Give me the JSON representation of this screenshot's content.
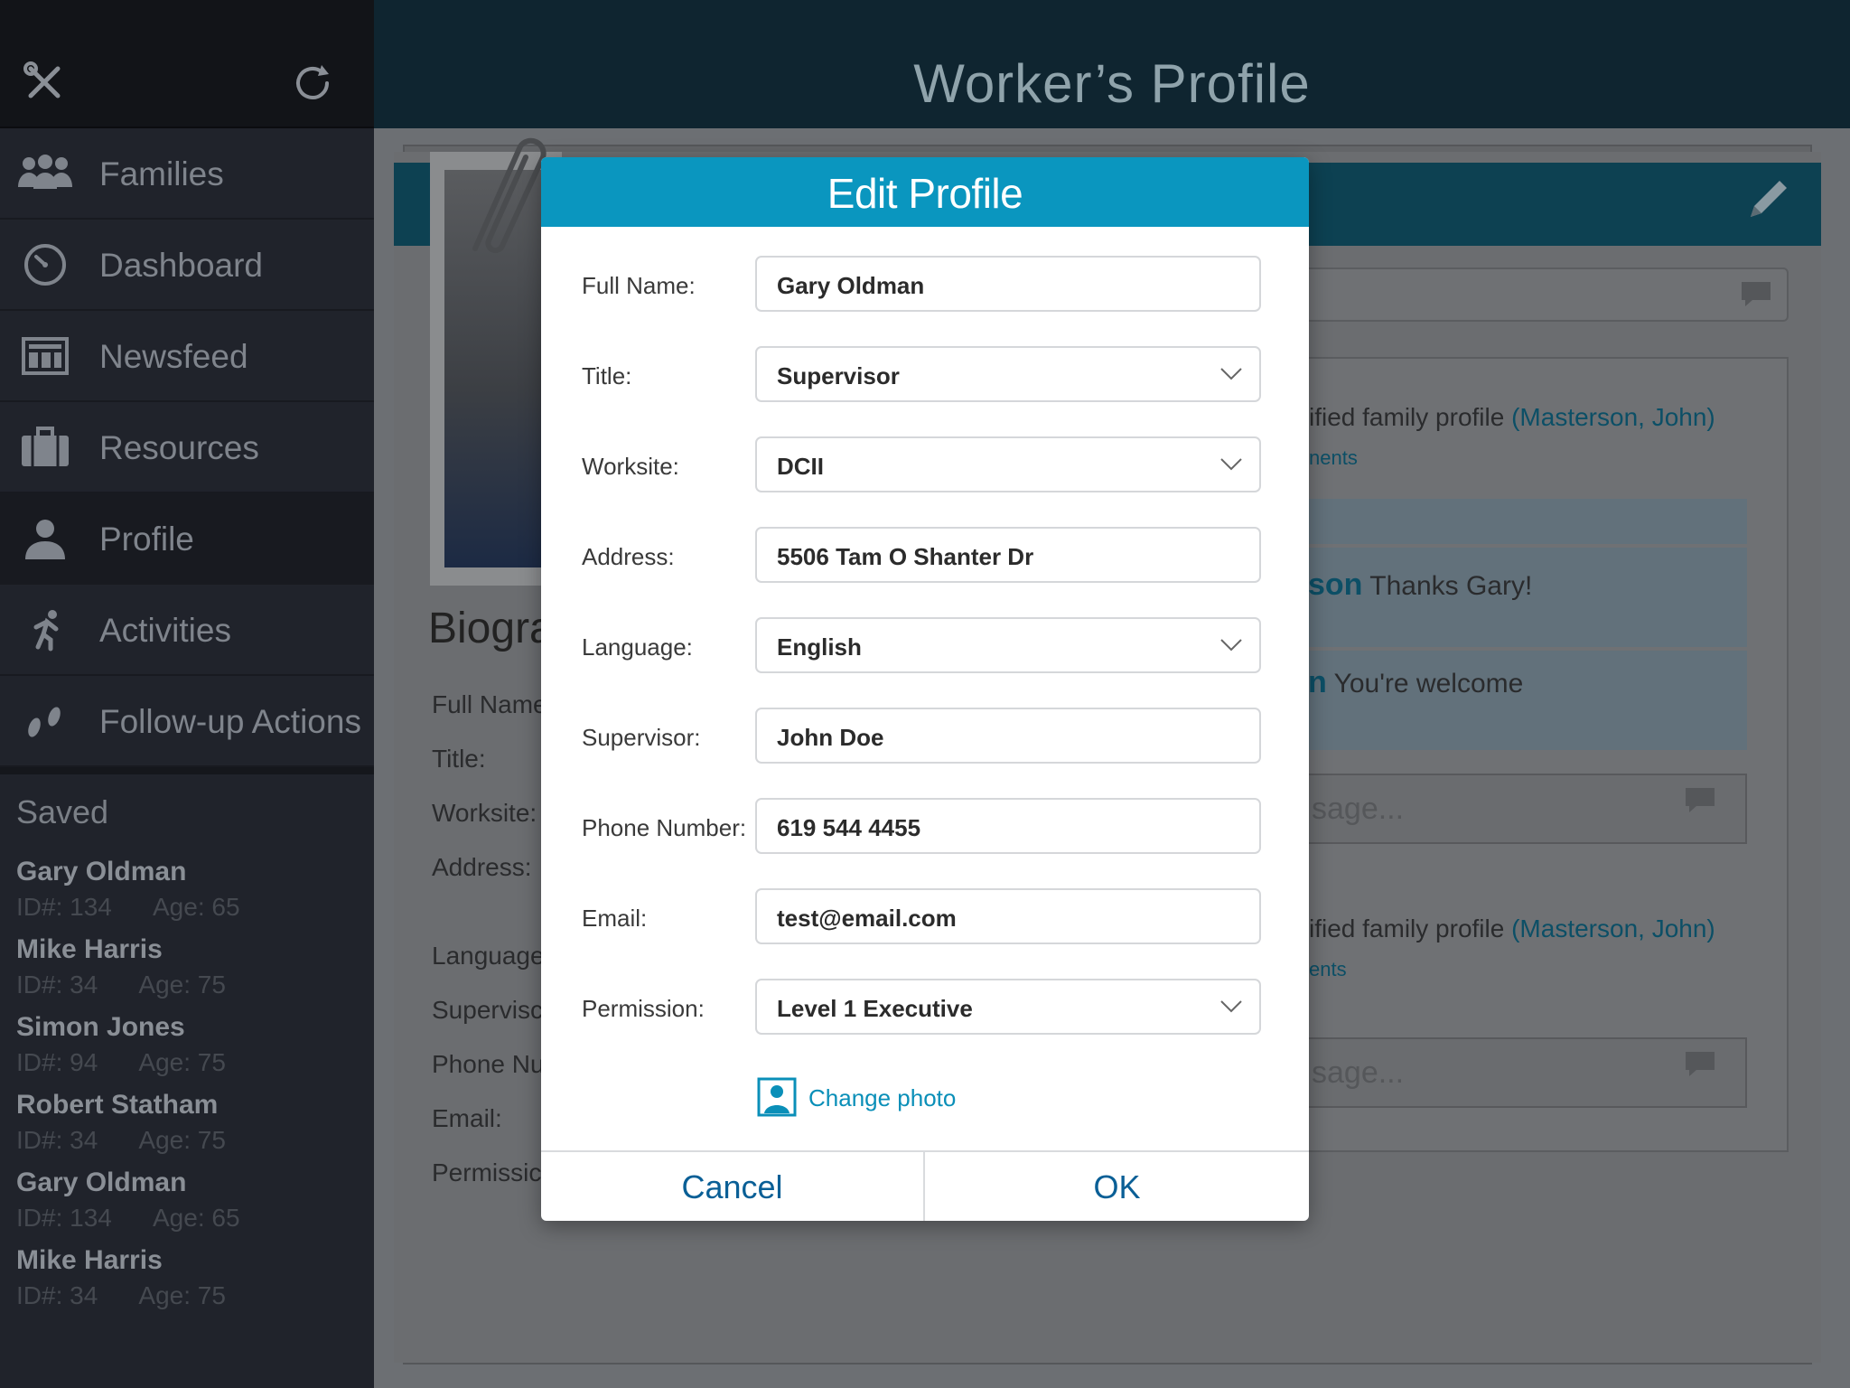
{
  "sidebar": {
    "nav": [
      {
        "label": "Families",
        "icon": "families-icon"
      },
      {
        "label": "Dashboard",
        "icon": "dashboard-icon"
      },
      {
        "label": "Newsfeed",
        "icon": "newsfeed-icon"
      },
      {
        "label": "Resources",
        "icon": "briefcase-icon"
      },
      {
        "label": "Profile",
        "icon": "person-icon"
      },
      {
        "label": "Activities",
        "icon": "running-person-icon"
      },
      {
        "label": "Follow-up Actions",
        "icon": "footprints-icon"
      }
    ],
    "active_index": 4,
    "saved_title": "Saved",
    "saved": [
      {
        "name": "Gary Oldman",
        "id": "ID#: 134",
        "age": "Age: 65"
      },
      {
        "name": "Mike Harris",
        "id": "ID#: 34",
        "age": "Age: 75"
      },
      {
        "name": "Simon Jones",
        "id": "ID#: 94",
        "age": "Age: 75"
      },
      {
        "name": "Robert Statham",
        "id": "ID#: 34",
        "age": "Age: 75"
      },
      {
        "name": "Gary Oldman",
        "id": "ID#: 134",
        "age": "Age: 65"
      },
      {
        "name": "Mike Harris",
        "id": "ID#: 34",
        "age": "Age: 75"
      }
    ]
  },
  "header": {
    "title": "Worker’s Profile"
  },
  "background": {
    "bio_title": "Biogra",
    "bio_labels": [
      "Full Name",
      "Title:",
      "Worksite:",
      "Address:",
      "Language",
      "Supervisc",
      "Phone Nu",
      "Email:",
      "Permissic"
    ],
    "feed": {
      "item1_text": "ified family profile ",
      "item1_link": "(Masterson, John)",
      "item1_sublink": "nents",
      "comment1_name": "son",
      "comment1_text": " Thanks Gary!",
      "comment2_name": "n",
      "comment2_text": " You're welcome",
      "message_placeholder": "sage...",
      "item2_text": "ified family profile ",
      "item2_link": "(Masterson, John)",
      "item2_sublink": "ents"
    }
  },
  "modal": {
    "title": "Edit Profile",
    "fields": {
      "full_name": {
        "label": "Full Name:",
        "value": "Gary Oldman"
      },
      "title": {
        "label": "Title:",
        "value": "Supervisor"
      },
      "worksite": {
        "label": "Worksite:",
        "value": "DCII"
      },
      "address": {
        "label": "Address:",
        "value": "5506 Tam O Shanter Dr"
      },
      "language": {
        "label": "Language:",
        "value": "English"
      },
      "supervisor": {
        "label": "Supervisor:",
        "value": "John Doe"
      },
      "phone": {
        "label": "Phone Number:",
        "value": "619 544 4455"
      },
      "email": {
        "label": "Email:",
        "value": "test@email.com"
      },
      "permission": {
        "label": "Permission:",
        "value": "Level 1 Executive"
      }
    },
    "change_photo": "Change photo",
    "cancel": "Cancel",
    "ok": "OK"
  },
  "colors": {
    "modal_header": "#0a96bf",
    "link": "#0a8fb8",
    "button_text": "#0a5f96",
    "sidebar_bg": "#20232b",
    "header_bg": "#0f2530"
  }
}
